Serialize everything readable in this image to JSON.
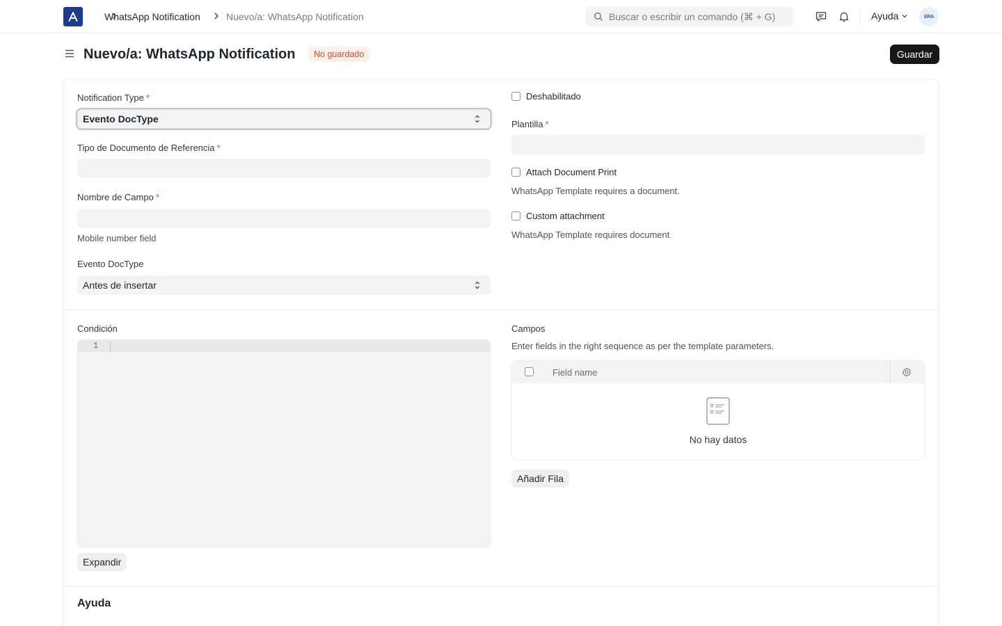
{
  "navbar": {
    "breadcrumbs": [
      "WhatsApp Notification",
      "Nuevo/a: WhatsApp Notification"
    ],
    "search_placeholder": "Buscar o escribir un comando (⌘ + G)",
    "help_label": "Ayuda",
    "avatar_initials": "ERA"
  },
  "page": {
    "title": "Nuevo/a: WhatsApp Notification",
    "status_badge": "No guardado",
    "save_label": "Guardar"
  },
  "form": {
    "notification_type": {
      "label": "Notification Type",
      "value": "Evento DocType"
    },
    "reference_doctype": {
      "label": "Tipo de Documento de Referencia",
      "value": ""
    },
    "field_name": {
      "label": "Nombre de Campo",
      "value": "",
      "description": "Mobile number field"
    },
    "doctype_event": {
      "label": "Evento DocType",
      "value": "Antes de insertar"
    },
    "disabled": {
      "label": "Deshabilitado",
      "checked": false
    },
    "template": {
      "label": "Plantilla",
      "value": ""
    },
    "attach_document_print": {
      "label": "Attach Document Print",
      "checked": false,
      "description": "WhatsApp Template requires a document."
    },
    "custom_attachment": {
      "label": "Custom attachment",
      "checked": false,
      "description": "WhatsApp Template requires document"
    },
    "condition": {
      "label": "Condición",
      "line_number": "1",
      "expand_label": "Expandir"
    },
    "fields": {
      "label": "Campos",
      "description": "Enter fields in the right sequence as per the template parameters.",
      "column_header": "Field name",
      "empty_text": "No hay datos",
      "add_row_label": "Añadir Fila"
    },
    "help_section": {
      "title": "Ayuda",
      "subtitle": "..."
    }
  },
  "colors": {
    "brand": "#1d3c8f",
    "primary_button": "#171717",
    "badge_bg": "#fdf0e8",
    "badge_text": "#c9512b",
    "required": "#e5484d"
  }
}
